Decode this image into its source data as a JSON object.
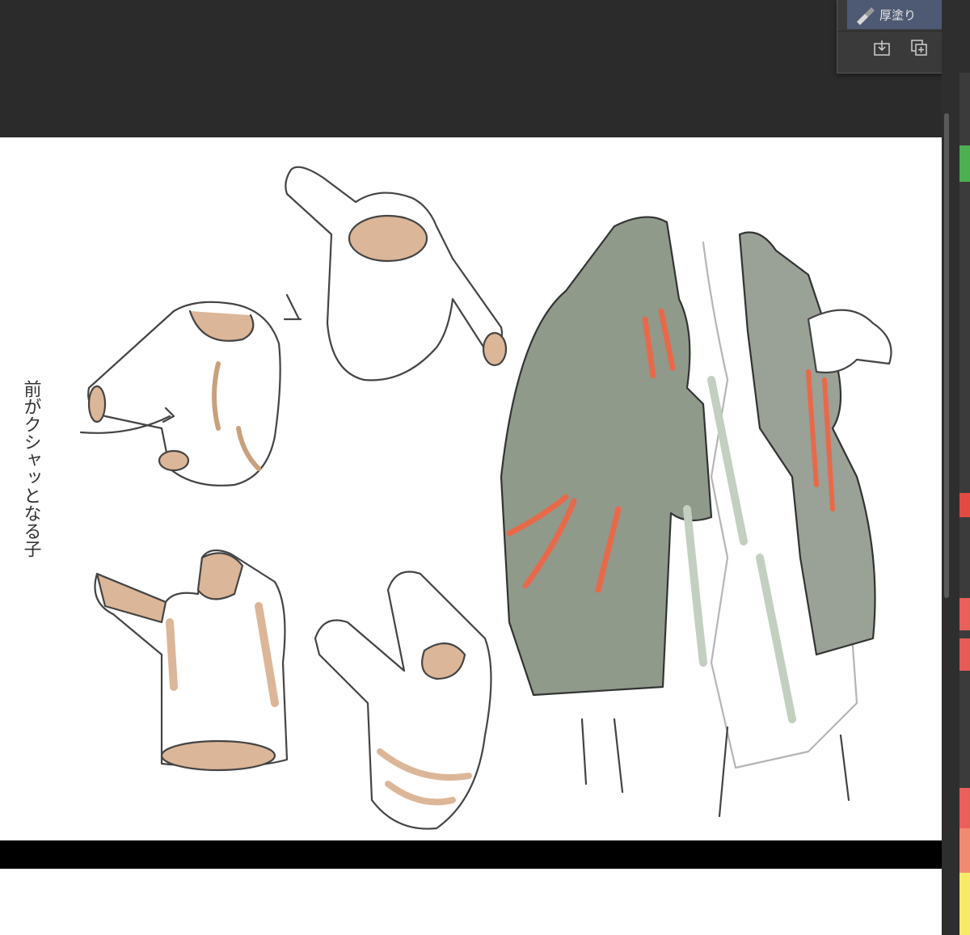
{
  "brush_panel": {
    "selected_brush_label": "厚塗り",
    "selected_brush_icon": "brush-icon",
    "actions": [
      {
        "name": "import-brush-button",
        "icon": "download-icon"
      },
      {
        "name": "duplicate-brush-button",
        "icon": "duplicate-icon"
      },
      {
        "name": "delete-brush-button",
        "icon": "trash-icon"
      }
    ]
  },
  "canvas": {
    "handwritten_note": "前がクシャッとなる子"
  },
  "colors": {
    "workspace": "#2b2b2b",
    "panel": "#3a3a3a",
    "brush_highlight": "#4e5a73",
    "skin": "#dcb698",
    "jacket": "#8f9a8b",
    "accent": "#e8694a",
    "palette": [
      "#4caf50",
      "#e04b42",
      "#e8605a",
      "#e45c55",
      "#f08a70",
      "#f5a85a",
      "#f7ea6b"
    ]
  }
}
